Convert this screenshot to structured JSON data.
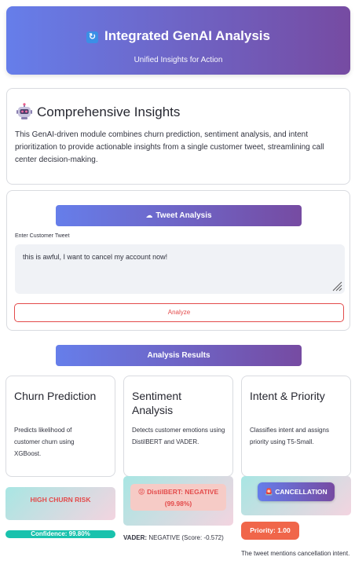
{
  "header": {
    "title": "Integrated GenAI Analysis",
    "subtitle": "Unified Insights for Action",
    "icon": "sync-icon"
  },
  "insights": {
    "icon": "robot-icon",
    "title": "Comprehensive Insights",
    "text": "This GenAI-driven module combines churn prediction, sentiment analysis, and intent prioritization to provide actionable insights from a single customer tweet, streamlining call center decision-making."
  },
  "tweet": {
    "section_label": "Tweet Analysis",
    "section_icon": "speech-bubble-icon",
    "input_label": "Enter Customer Tweet",
    "input_value": "this is awful, I want to cancel my account now!",
    "analyze_label": "Analyze"
  },
  "results": {
    "section_label": "Analysis Results",
    "churn": {
      "title": "Churn Prediction",
      "description": "Predicts likelihood of customer churn using XGBoost.",
      "risk_label": "HIGH CHURN RISK",
      "confidence_label": "Confidence: 99.80%",
      "confidence": 0.998
    },
    "sentiment": {
      "title": "Sentiment Analysis",
      "description": "Detects customer emotions using DistilBERT and VADER.",
      "distilbert_label": "DistilBERT: NEGATIVE",
      "distilbert_score": "(99.98%)",
      "distilbert_icon": "angry-face-icon",
      "vader_label": "VADER:",
      "vader_value": "NEGATIVE (Score: -0.572)"
    },
    "intent": {
      "title": "Intent & Priority",
      "description": "Classifies intent and assigns priority using T5-Small.",
      "intent_label": "CANCELLATION",
      "intent_icon": "siren-icon",
      "priority_label": "Priority: 1.00",
      "note": "The tweet mentions cancellation intent."
    }
  },
  "colors": {
    "gradient_start": "#667eea",
    "gradient_end": "#764ba2",
    "danger": "#e34b4b",
    "confidence_bar": "#19c2ad",
    "priority_badge": "#f0664a"
  }
}
